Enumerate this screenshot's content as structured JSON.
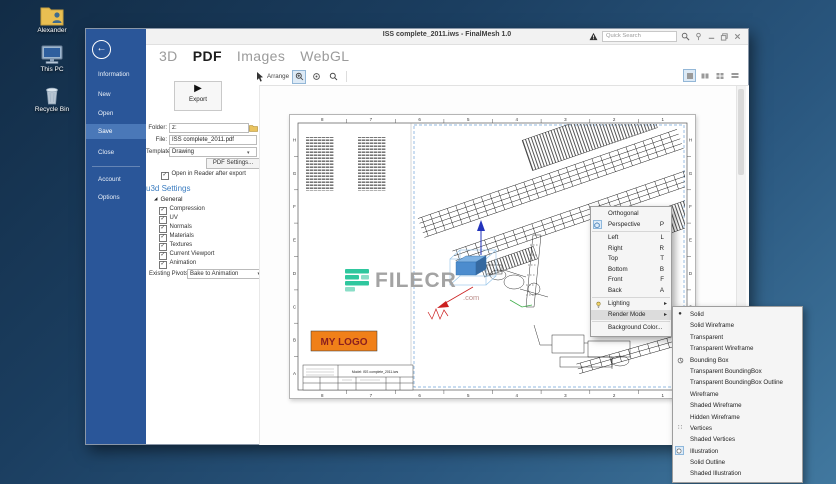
{
  "desktop": {
    "icons": [
      {
        "label": "Alexander"
      },
      {
        "label": "This PC"
      },
      {
        "label": "Recycle Bin"
      }
    ]
  },
  "window": {
    "title": "ISS complete_2011.iws - FinalMesh 1.0",
    "quick_search_placeholder": "Quick Search"
  },
  "ribbon": {
    "tabs": [
      {
        "label": "3D"
      },
      {
        "label": "PDF"
      },
      {
        "label": "Images"
      },
      {
        "label": "WebGL"
      }
    ],
    "active_tab": "PDF"
  },
  "toolbar": {
    "arrange_label": "Arrange"
  },
  "sidebar": {
    "items": [
      {
        "label": "Information"
      },
      {
        "label": "New"
      },
      {
        "label": "Open"
      },
      {
        "label": "Save"
      },
      {
        "label": "Close"
      },
      {
        "label": "Account"
      },
      {
        "label": "Options"
      }
    ],
    "active_item": "Save"
  },
  "export_panel": {
    "export_label": "Export",
    "folder_label": "Folder:",
    "folder_value": "z:",
    "file_label": "File:",
    "file_value": "ISS complete_2011.pdf",
    "template_label": "Template:",
    "template_value": "Drawing",
    "pdf_settings_label": "PDF Settings...",
    "open_in_reader_label": "Open in Reader after export",
    "open_in_reader_checked": true,
    "u3d_heading": "u3d Settings",
    "tree_group_label": "General",
    "options": [
      "Compression",
      "UV",
      "Normals",
      "Materials",
      "Textures",
      "Current Viewport",
      "Animation"
    ],
    "options_checked": [
      true,
      true,
      true,
      true,
      true,
      true,
      true
    ],
    "existing_pivots_label": "Existing Pivots:",
    "existing_pivots_value": "Bake to Animation"
  },
  "context_menu": {
    "items": [
      {
        "label": "Orthogonal",
        "shortcut": ""
      },
      {
        "label": "Perspective",
        "shortcut": "P"
      },
      {
        "label": "Left",
        "shortcut": "L"
      },
      {
        "label": "Right",
        "shortcut": "R"
      },
      {
        "label": "Top",
        "shortcut": "T"
      },
      {
        "label": "Bottom",
        "shortcut": "B"
      },
      {
        "label": "Front",
        "shortcut": "F"
      },
      {
        "label": "Back",
        "shortcut": "A"
      },
      {
        "label": "Lighting",
        "shortcut": ""
      },
      {
        "label": "Render Mode",
        "shortcut": ""
      },
      {
        "label": "Background Color...",
        "shortcut": ""
      }
    ]
  },
  "render_mode_submenu": {
    "items": [
      "Solid",
      "Solid Wireframe",
      "Transparent",
      "Transparent Wireframe",
      "Bounding Box",
      "Transparent BoundingBox",
      "Transparent BoundingBox Outline",
      "Wireframe",
      "Shaded Wireframe",
      "Hidden Wireframe",
      "Vertices",
      "Shaded Vertices",
      "Illustration",
      "Solid Outline",
      "Shaded Illustration"
    ]
  },
  "page": {
    "grid_numbers": [
      "8",
      "7",
      "6",
      "5",
      "4",
      "3",
      "2",
      "1"
    ],
    "grid_letters": [
      "H",
      "G",
      "F",
      "E",
      "D",
      "C",
      "B",
      "A"
    ],
    "logo_text": "MY LOGO",
    "title_block_model": "Model: ISS complete_2011.iws"
  },
  "watermark": {
    "text": "FILECR",
    "suffix": ".com"
  },
  "glyphs": {
    "back_arrow": "←",
    "play": "▶",
    "dropdown": "▾",
    "submenu_arrow": "▸",
    "check": "✓",
    "tree_expanded": "◢",
    "vertices": "∷",
    "solid_dot": "●"
  },
  "colors": {
    "sidebar": "#2a5699",
    "sidebar_active": "#4a78b8",
    "accent": "#3a7cc0",
    "logo_bg": "#f08019",
    "logo_text": "#8b1f1f",
    "watermark_teal": "#2fc79e"
  }
}
